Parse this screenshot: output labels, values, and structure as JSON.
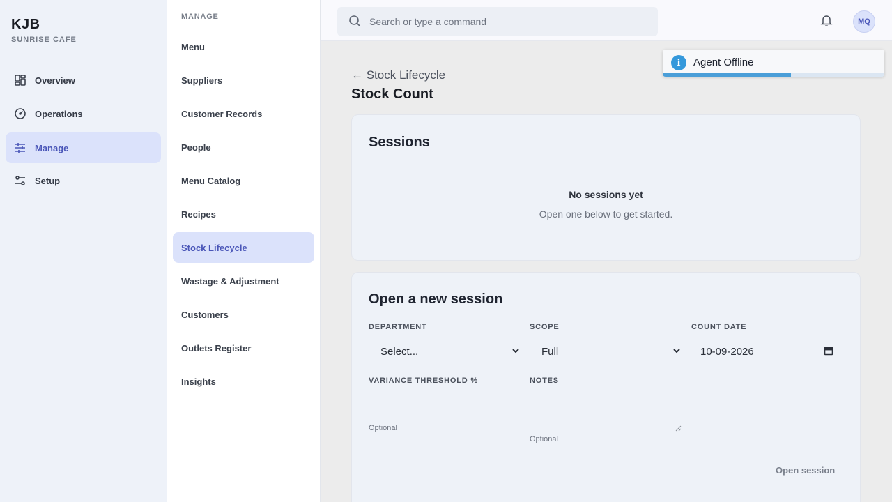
{
  "brand": {
    "name": "KJB",
    "subtitle": "SUNRISE CAFE"
  },
  "rail": {
    "items": [
      {
        "label": "Overview",
        "icon": "grid-icon",
        "active": false
      },
      {
        "label": "Operations",
        "icon": "gauge-icon",
        "active": false
      },
      {
        "label": "Manage",
        "icon": "sliders-icon",
        "active": true
      },
      {
        "label": "Setup",
        "icon": "toggles-icon",
        "active": false
      }
    ]
  },
  "subnav": {
    "heading": "MANAGE",
    "items": [
      {
        "label": "Menu"
      },
      {
        "label": "Suppliers"
      },
      {
        "label": "Customer Records"
      },
      {
        "label": "People"
      },
      {
        "label": "Menu Catalog"
      },
      {
        "label": "Recipes"
      },
      {
        "label": "Stock Lifecycle",
        "active": true
      },
      {
        "label": "Wastage & Adjustment"
      },
      {
        "label": "Customers"
      },
      {
        "label": "Outlets Register"
      },
      {
        "label": "Insights"
      }
    ]
  },
  "topbar": {
    "search_placeholder": "Search or type a command",
    "avatar_initials": "MQ"
  },
  "toast": {
    "text": "Agent Offline",
    "progress": 0.58,
    "accent": "#3498db"
  },
  "main": {
    "back_label": "← Stock Lifecycle",
    "title": "Stock Count",
    "sessions": {
      "title": "Sessions",
      "empty_title": "No sessions yet",
      "empty_sub": "Open one below to get started."
    },
    "new_session": {
      "title": "Open a new session",
      "department_label": "DEPARTMENT",
      "department_value": "Select...",
      "scope_label": "SCOPE",
      "scope_value": "Full",
      "count_date_label": "COUNT DATE",
      "count_date_value": "10-09-2026",
      "variance_label": "VARIANCE THRESHOLD %",
      "variance_hint": "Optional",
      "notes_label": "NOTES",
      "notes_hint": "Optional",
      "submit_label": "Open session"
    }
  },
  "colors": {
    "accent": "#4a56b8",
    "accent_bg": "#dbe2fb"
  }
}
